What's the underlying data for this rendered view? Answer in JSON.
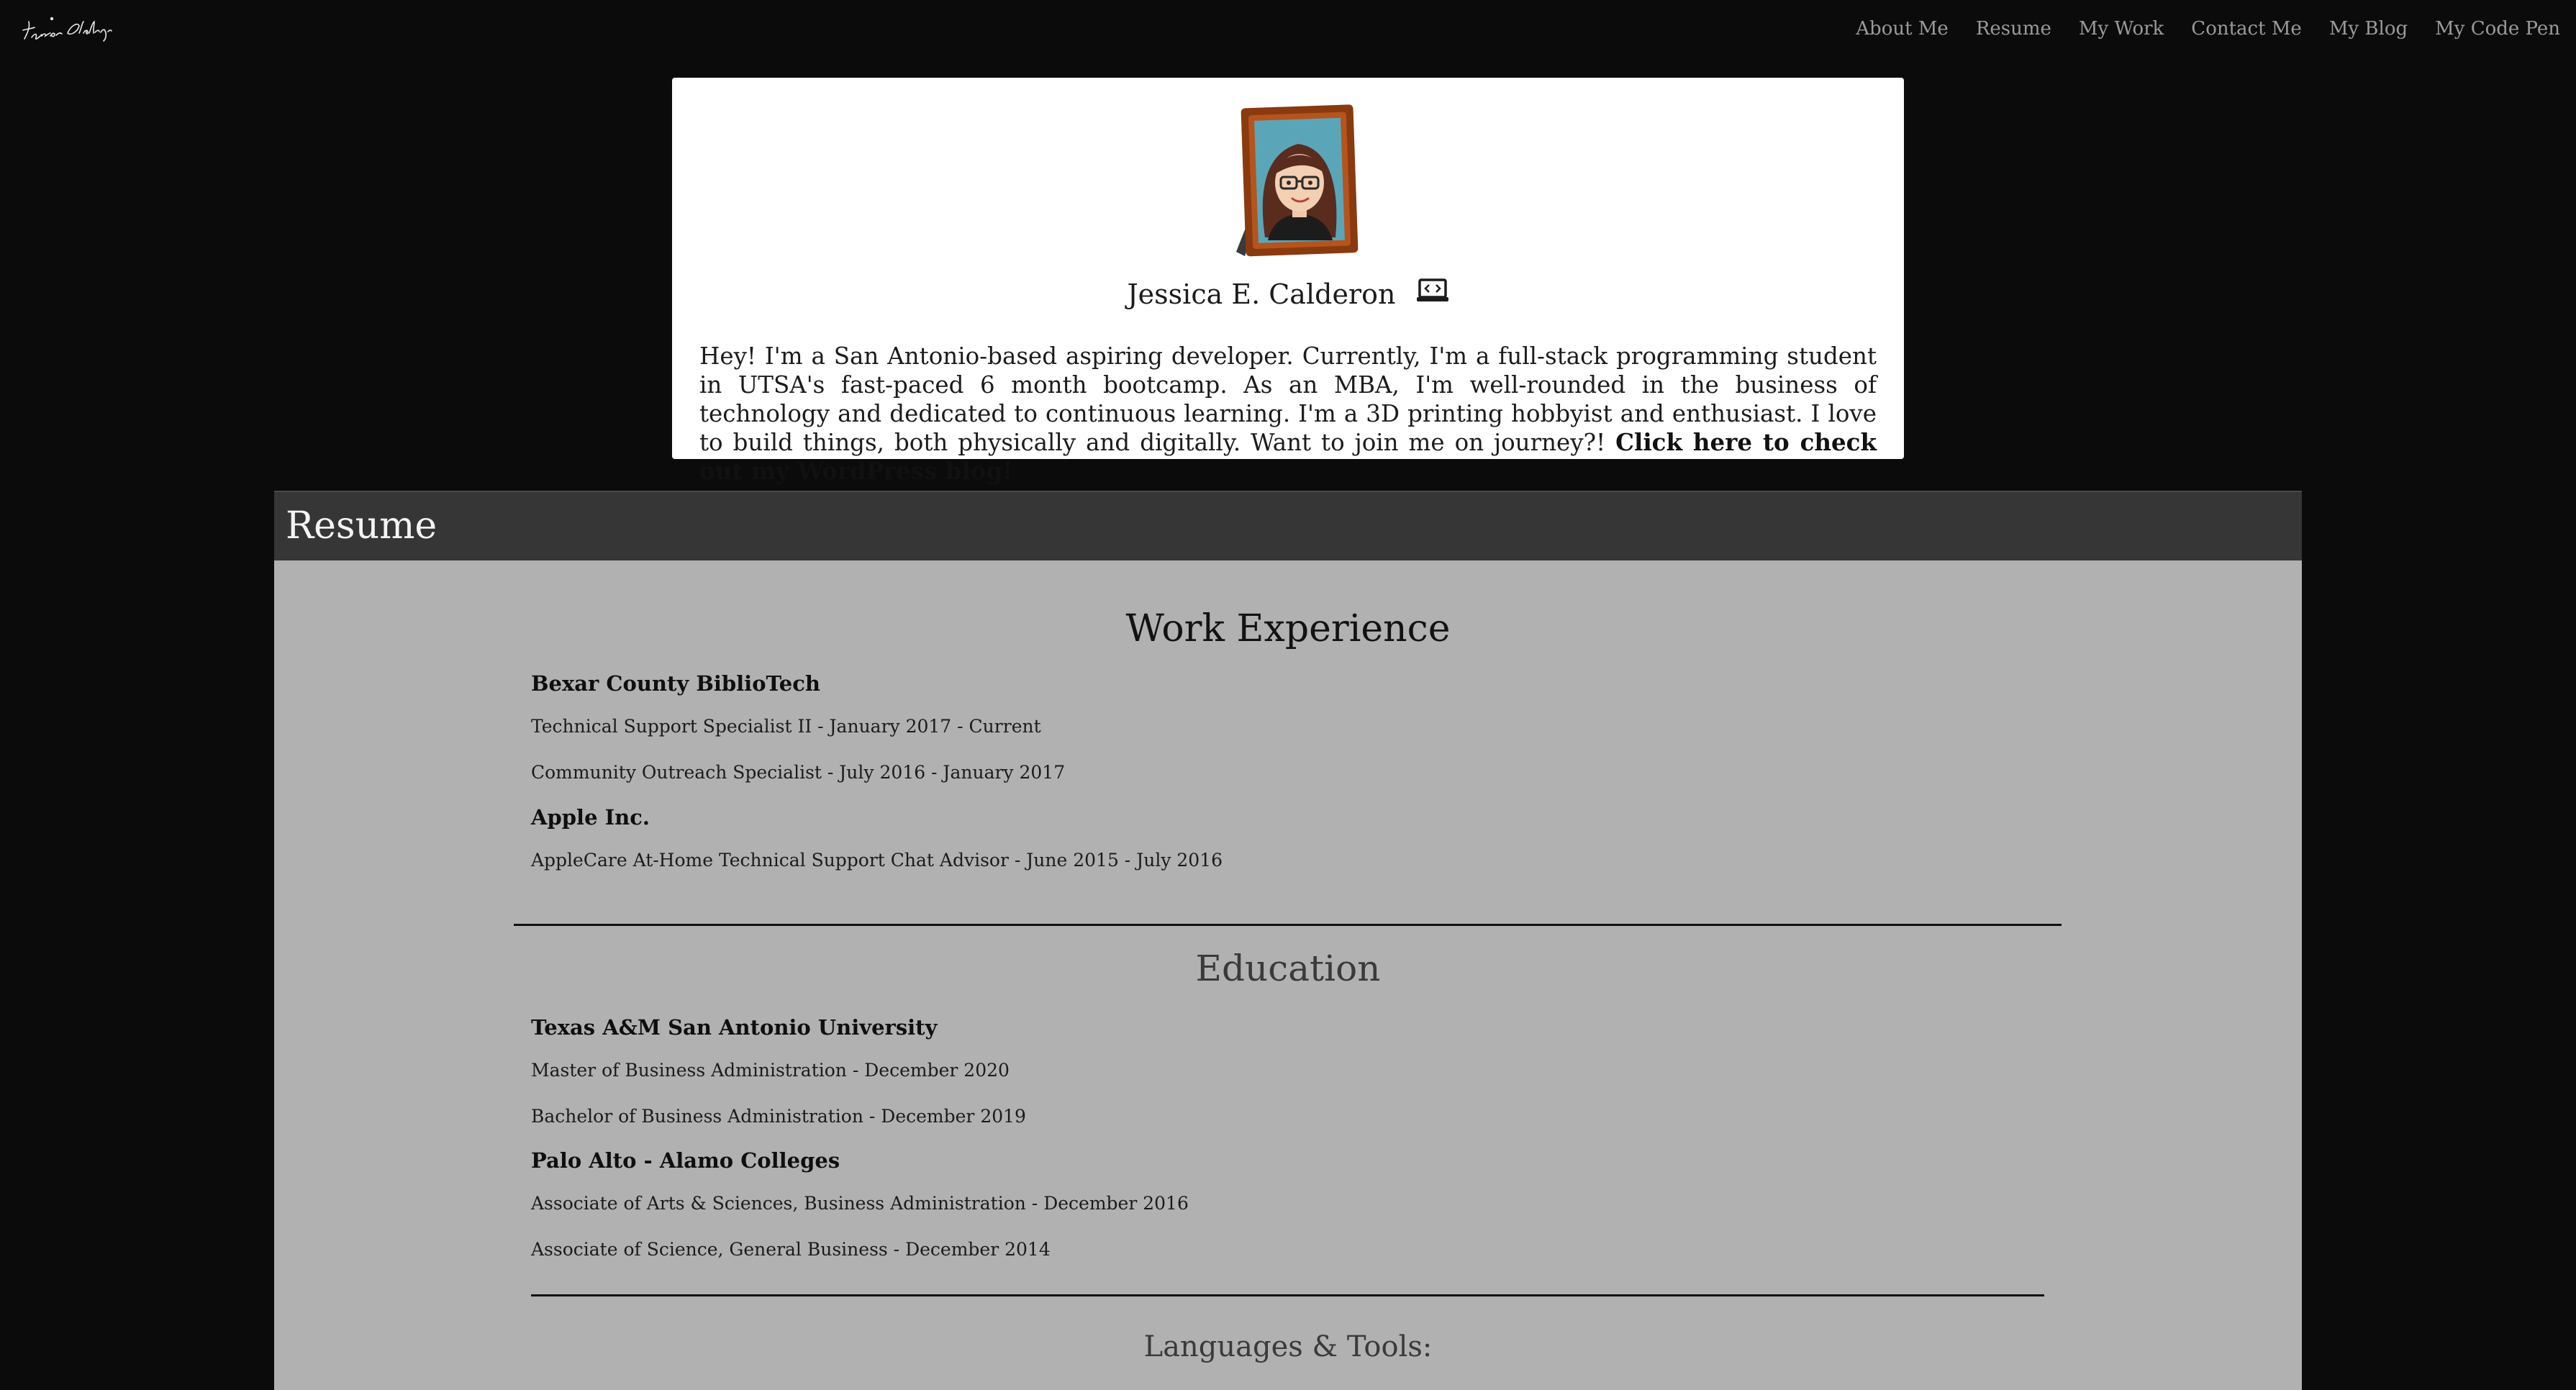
{
  "nav": {
    "brand_alt": "Jessica Calderon",
    "links": [
      "About Me",
      "Resume",
      "My Work",
      "Contact Me",
      "My Blog",
      "My Code Pen"
    ]
  },
  "intro": {
    "name": "Jessica E. Calderon",
    "bio": "Hey! I'm a San Antonio-based aspiring developer. Currently, I'm a full-stack programming student in UTSA's fast-paced 6 month bootcamp. As an MBA, I'm well-rounded in the business of technology and dedicated to continuous learning. I'm a 3D printing hobbyist and enthusiast. I love to build things, both physically and digitally. Want to join me on journey?!",
    "blog_link": "Click here to check out my WordPress blog!"
  },
  "resume": {
    "title": "Resume",
    "work": {
      "heading": "Work Experience",
      "orgs": [
        {
          "name": "Bexar County BiblioTech",
          "roles": [
            "Technical Support Specialist II - January 2017 - Current",
            "Community Outreach Specialist - July 2016 - January 2017"
          ]
        },
        {
          "name": "Apple Inc.",
          "roles": [
            "AppleCare At-Home Technical Support Chat Advisor - June 2015 - July 2016"
          ]
        }
      ]
    },
    "education": {
      "heading": "Education",
      "orgs": [
        {
          "name": "Texas A&M San Antonio University",
          "roles": [
            "Master of Business Administration - December 2020",
            "Bachelor of Business Administration - December 2019"
          ]
        },
        {
          "name": "Palo Alto - Alamo Colleges",
          "roles": [
            "Associate of Arts & Sciences, Business Administration - December 2016",
            "Associate of Science, General Business - December 2014"
          ]
        }
      ]
    },
    "languages_heading": "Languages & Tools:"
  },
  "colors": {
    "page_bg": "#0b0b0b",
    "header_bar": "#363636",
    "resume_bg": "#b1b1b1",
    "card_bg": "#ffffff",
    "nav_text": "#9a9a9a"
  },
  "icons": [
    "signature-logo",
    "avatar-portrait",
    "laptop-code-icon"
  ]
}
